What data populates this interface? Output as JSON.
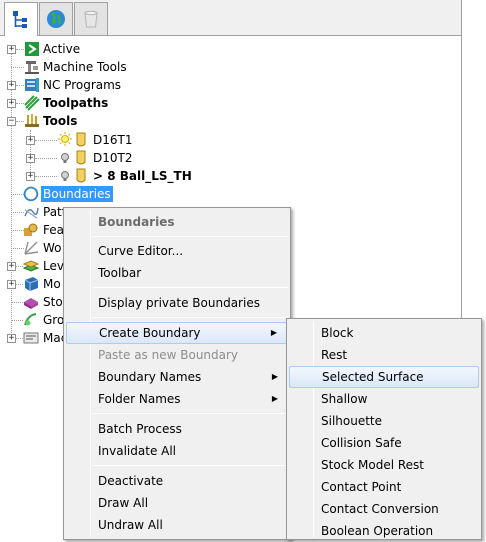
{
  "tabs": [
    {
      "name": "explorer-tab",
      "icon": "tree-hierarchy-icon",
      "active": true
    },
    {
      "name": "globe-tab",
      "icon": "globe-icon",
      "active": false
    },
    {
      "name": "recycle-bin-tab",
      "icon": "recycle-bin-icon",
      "active": false
    }
  ],
  "tree": {
    "active": "Active",
    "machine_tools": "Machine Tools",
    "nc_programs": "NC Programs",
    "toolpaths": "Toolpaths",
    "tools": "Tools",
    "tool_1": "D16T1",
    "tool_2": "D10T2",
    "tool_3": "> 8 Ball_LS_TH",
    "boundaries": "Boundaries",
    "patterns_partial": "Patt",
    "features_partial": "Feat",
    "workplanes_partial": "Wo",
    "levels_partial": "Lev",
    "models_partial": "Mo",
    "stock_partial": "Stoc",
    "groups_partial": "Gro",
    "macros_partial": "Mac"
  },
  "context_menu": {
    "header": "Boundaries",
    "curve_editor": "Curve Editor...",
    "toolbar": "Toolbar",
    "display_private": "Display private Boundaries",
    "create_boundary": "Create Boundary",
    "paste_as_new": "Paste as new Boundary",
    "boundary_names": "Boundary Names",
    "folder_names": "Folder Names",
    "batch_process": "Batch Process",
    "invalidate_all": "Invalidate All",
    "deactivate": "Deactivate",
    "draw_all": "Draw All",
    "undraw_all": "Undraw All"
  },
  "submenu": {
    "items": [
      "Block",
      "Rest",
      "Selected Surface",
      "Shallow",
      "Silhouette",
      "Collision Safe",
      "Stock Model Rest",
      "Contact Point",
      "Contact Conversion",
      "Boolean Operation"
    ],
    "highlighted": "Selected Surface"
  },
  "colors": {
    "selection": "#3399ff",
    "menu_bg": "#f0f0f0",
    "highlight_border": "#aeccf1"
  }
}
